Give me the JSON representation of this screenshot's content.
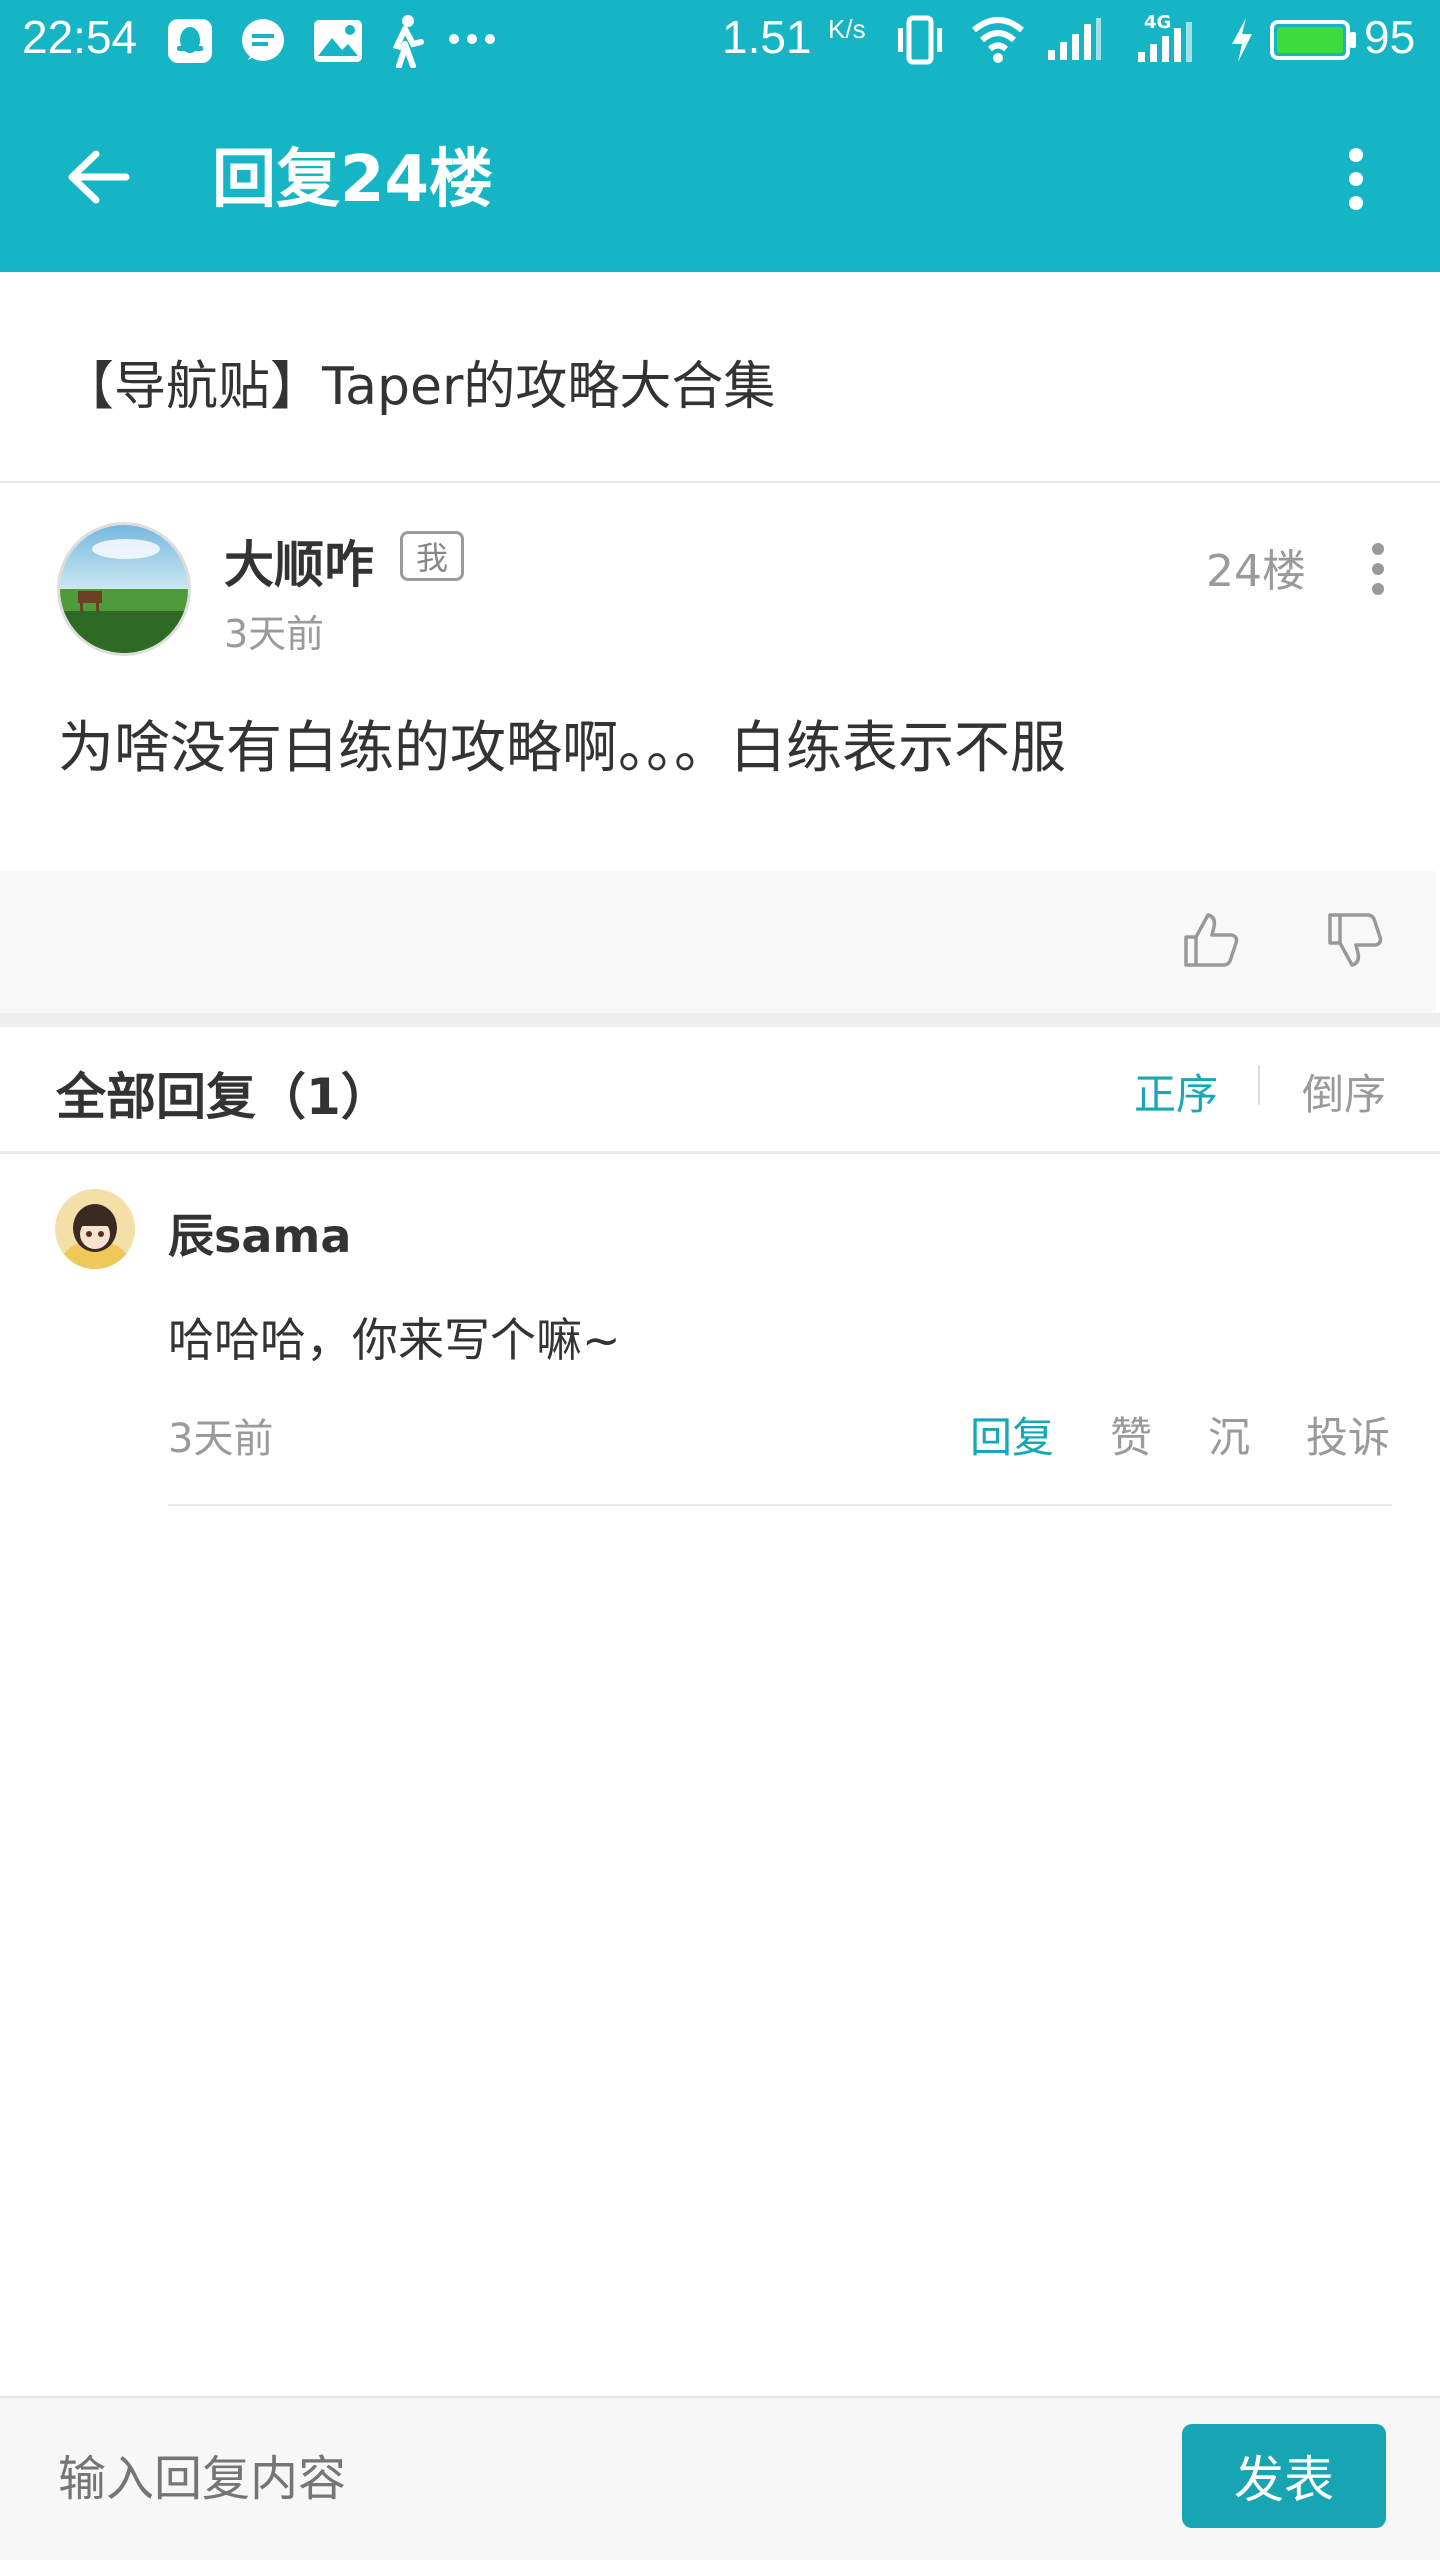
{
  "status_bar": {
    "time": "22:54",
    "speed": "1.51",
    "speed_unit": "K/s",
    "net_type": "4G",
    "battery": "95",
    "icons": [
      "qq-icon",
      "message-icon",
      "image-icon",
      "walk-icon",
      "more-dots-icon",
      "vibrate-icon",
      "wifi-icon",
      "signal-icon",
      "signal-4g-icon",
      "charging-icon",
      "battery-icon"
    ]
  },
  "header": {
    "title": "回复24楼",
    "back_icon": "arrow-left-icon",
    "menu_icon": "more-vertical-icon"
  },
  "thread": {
    "title": "【导航贴】Taper的攻略大合集"
  },
  "post": {
    "author": "大顺咋",
    "badge": "我",
    "time": "3天前",
    "floor": "24楼",
    "content": "为啥没有白练的攻略啊。。。白练表示不服",
    "like_icon": "thumbs-up-icon",
    "dislike_icon": "thumbs-down-icon"
  },
  "replies": {
    "header": "全部回复（1）",
    "sort_asc": "正序",
    "sort_desc": "倒序",
    "items": [
      {
        "author": "辰sama",
        "content": "哈哈哈，你来写个嘛~",
        "time": "3天前",
        "actions": [
          "回复",
          "赞",
          "沉",
          "投诉"
        ]
      }
    ]
  },
  "composer": {
    "placeholder": "输入回复内容",
    "send_label": "发表"
  },
  "colors": {
    "accent": "#15b5c5",
    "send_button": "#17a4b3",
    "active_text": "#15a9b8"
  }
}
